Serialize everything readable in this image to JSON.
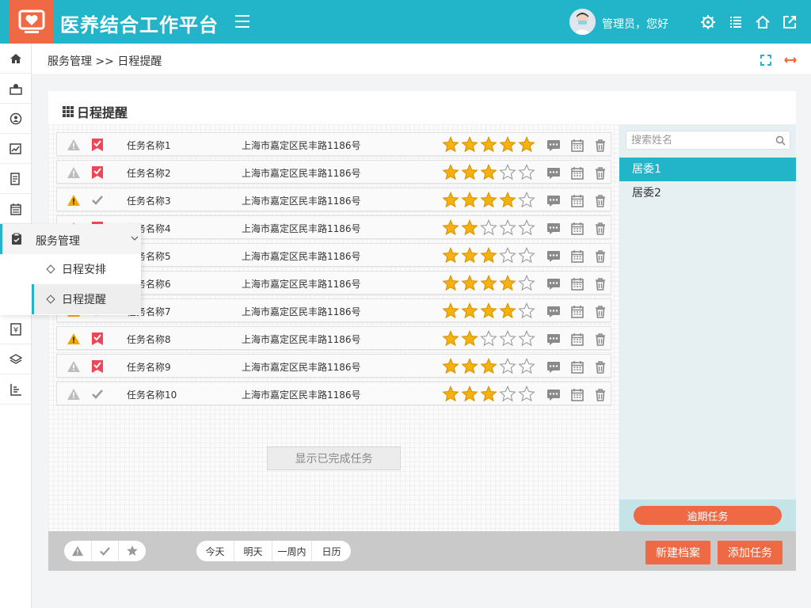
{
  "app": {
    "title": "医养结合工作平台",
    "greeting": "管理员，您好"
  },
  "breadcrumb": "服务管理 >> 日程提醒",
  "panel_title": "日程提醒",
  "nav": {
    "group_label": "服务管理",
    "items": [
      {
        "label": "日程安排"
      },
      {
        "label": "日程提醒"
      }
    ]
  },
  "tasks": [
    {
      "name": "任务名称1",
      "address": "上海市嘉定区民丰路1186号",
      "warn": false,
      "flag": "red",
      "rating": 5
    },
    {
      "name": "任务名称2",
      "address": "上海市嘉定区民丰路1186号",
      "warn": false,
      "flag": "red",
      "rating": 3
    },
    {
      "name": "任务名称3",
      "address": "上海市嘉定区民丰路1186号",
      "warn": true,
      "flag": "check",
      "rating": 4
    },
    {
      "name": "任务名称4",
      "address": "上海市嘉定区民丰路1186号",
      "warn": true,
      "flag": "red",
      "rating": 2
    },
    {
      "name": "任务名称5",
      "address": "上海市嘉定区民丰路1186号",
      "warn": false,
      "flag": "red",
      "rating": 3
    },
    {
      "name": "任务名称6",
      "address": "上海市嘉定区民丰路1186号",
      "warn": false,
      "flag": "red",
      "rating": 4
    },
    {
      "name": "任务名称7",
      "address": "上海市嘉定区民丰路1186号",
      "warn": true,
      "flag": "check",
      "rating": 4
    },
    {
      "name": "任务名称8",
      "address": "上海市嘉定区民丰路1186号",
      "warn": true,
      "flag": "red",
      "rating": 2
    },
    {
      "name": "任务名称9",
      "address": "上海市嘉定区民丰路1186号",
      "warn": false,
      "flag": "red",
      "rating": 3
    },
    {
      "name": "任务名称10",
      "address": "上海市嘉定区民丰路1186号",
      "warn": false,
      "flag": "check",
      "rating": 3
    }
  ],
  "show_done_label": "显示已完成任务",
  "search": {
    "placeholder": "搜索姓名"
  },
  "residents": [
    {
      "label": "居委1",
      "selected": true
    },
    {
      "label": "居委2",
      "selected": false
    }
  ],
  "overdue_label": "逾期任务",
  "date_filters": [
    "今天",
    "明天",
    "一周内",
    "日历"
  ],
  "new_record_label": "新建档案",
  "add_task_label": "添加任务",
  "colors": {
    "primary": "#22b5c9",
    "accent": "#ee6944",
    "star": "#f5b10f",
    "flag": "#ee4558",
    "warn": "#f0a800"
  }
}
